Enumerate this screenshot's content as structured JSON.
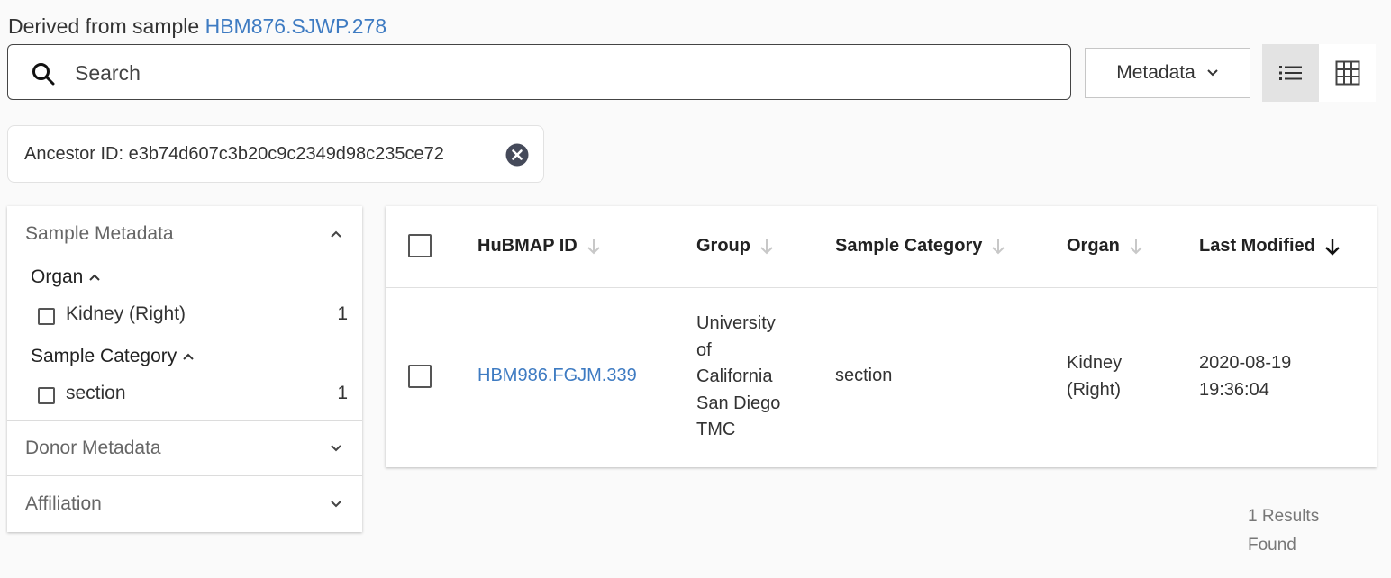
{
  "derived": {
    "prefix": "Derived from sample",
    "sample_id": "HBM876.SJWP.278"
  },
  "search": {
    "placeholder": "Search",
    "value": ""
  },
  "metadata_button": {
    "label": "Metadata"
  },
  "view_toggle": {
    "list_icon": "list-icon",
    "grid_icon": "grid-icon",
    "active": "list"
  },
  "filter_chip": {
    "label": "Ancestor ID: e3b74d607c3b20c9c2349d98c235ce72"
  },
  "sidebar": {
    "sample_metadata": {
      "title": "Sample Metadata",
      "organ": {
        "title": "Organ",
        "items": [
          {
            "label": "Kidney (Right)",
            "count": "1"
          }
        ]
      },
      "sample_category": {
        "title": "Sample Category",
        "items": [
          {
            "label": "section",
            "count": "1"
          }
        ]
      }
    },
    "donor_metadata": {
      "title": "Donor Metadata"
    },
    "affiliation": {
      "title": "Affiliation"
    }
  },
  "table": {
    "columns": [
      "HuBMAP ID",
      "Group",
      "Sample Category",
      "Organ",
      "Last Modified"
    ],
    "rows": [
      {
        "hubmap_id": "HBM986.FGJM.339",
        "group": [
          "University",
          "of",
          "California",
          "San Diego",
          "TMC"
        ],
        "sample_category": "section",
        "organ": [
          "Kidney",
          "(Right)"
        ],
        "last_modified": [
          "2020-08-19",
          "19:36:04"
        ]
      }
    ]
  },
  "results": {
    "line1": "1 Results",
    "line2": "Found"
  },
  "colors": {
    "link": "#3e7bc2",
    "active_toggle": "#e3e3e3"
  }
}
